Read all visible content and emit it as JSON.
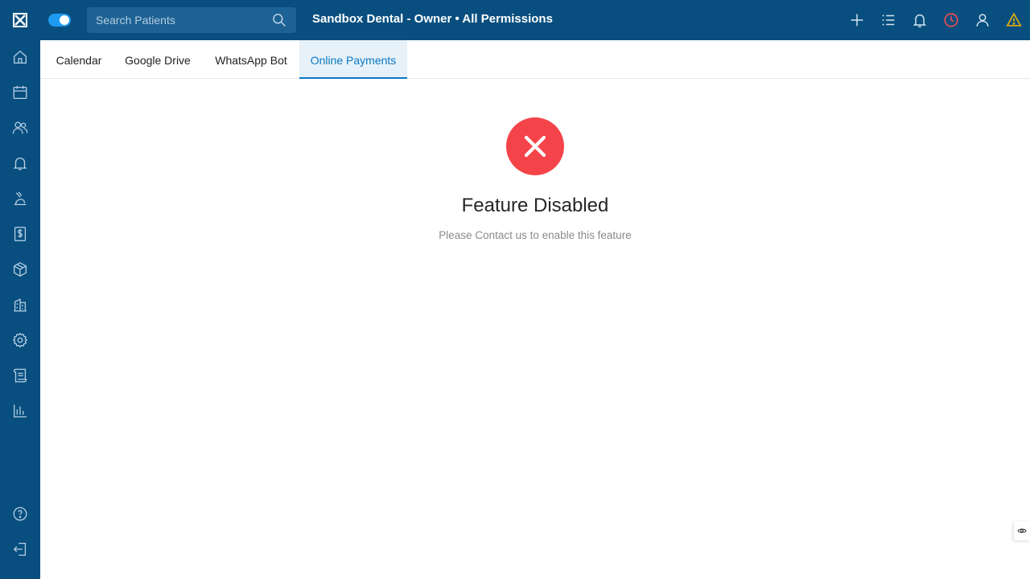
{
  "header": {
    "title": "Sandbox Dental - Owner • All Permissions",
    "search_placeholder": "Search Patients",
    "search_value": "",
    "toggle_on": true,
    "actions": [
      "plus-icon",
      "list-icon",
      "bell-icon",
      "clock-icon",
      "user-icon",
      "warning-icon"
    ]
  },
  "sidebar": {
    "items": [
      "home-icon",
      "calendar-icon",
      "patients-icon",
      "notifications-icon",
      "treatment-icon",
      "billing-icon",
      "inventory-icon",
      "clinic-icon",
      "settings-icon",
      "documents-icon",
      "reports-icon"
    ],
    "bottom_items": [
      "help-icon",
      "logout-icon"
    ]
  },
  "tabs": [
    {
      "label": "Calendar",
      "active": false
    },
    {
      "label": "Google Drive",
      "active": false
    },
    {
      "label": "WhatsApp Bot",
      "active": false
    },
    {
      "label": "Online Payments",
      "active": true
    }
  ],
  "main": {
    "title": "Feature Disabled",
    "message": "Please Contact us to enable this feature"
  },
  "colors": {
    "nav": "#084f80",
    "accent": "#0a78c2",
    "error": "#f4444a",
    "warning": "#f5b400"
  }
}
